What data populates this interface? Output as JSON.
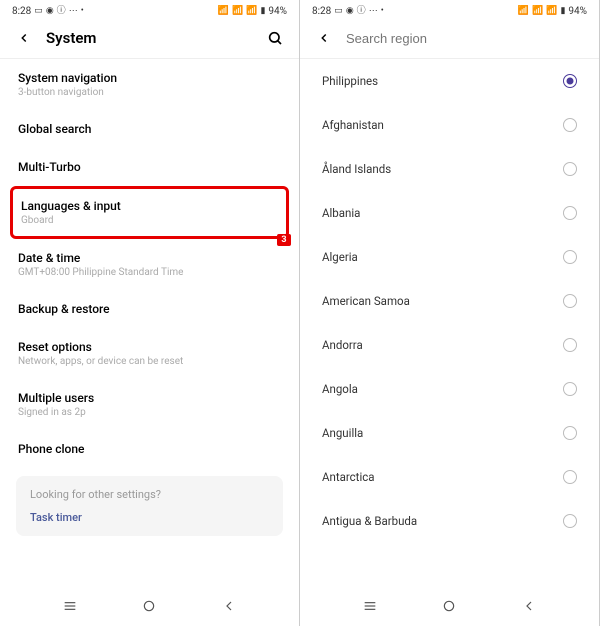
{
  "status": {
    "time": "8:28",
    "battery": "94%"
  },
  "left": {
    "header_title": "System",
    "highlight_badge": "3",
    "items": [
      {
        "title": "System navigation",
        "sub": "3-button navigation"
      },
      {
        "title": "Global search",
        "sub": ""
      },
      {
        "title": "Multi-Turbo",
        "sub": ""
      },
      {
        "title": "Languages & input",
        "sub": "Gboard"
      },
      {
        "title": "Date & time",
        "sub": "GMT+08:00 Philippine Standard Time"
      },
      {
        "title": "Backup & restore",
        "sub": ""
      },
      {
        "title": "Reset options",
        "sub": "Network, apps, or device can be reset"
      },
      {
        "title": "Multiple users",
        "sub": "Signed in as 2p"
      },
      {
        "title": "Phone clone",
        "sub": ""
      }
    ],
    "footer_question": "Looking for other settings?",
    "footer_link": "Task timer"
  },
  "right": {
    "search_placeholder": "Search region",
    "regions": [
      {
        "name": "Philippines",
        "selected": true
      },
      {
        "name": "Afghanistan",
        "selected": false
      },
      {
        "name": "Åland Islands",
        "selected": false
      },
      {
        "name": "Albania",
        "selected": false
      },
      {
        "name": "Algeria",
        "selected": false
      },
      {
        "name": "American Samoa",
        "selected": false
      },
      {
        "name": "Andorra",
        "selected": false
      },
      {
        "name": "Angola",
        "selected": false
      },
      {
        "name": "Anguilla",
        "selected": false
      },
      {
        "name": "Antarctica",
        "selected": false
      },
      {
        "name": "Antigua & Barbuda",
        "selected": false
      }
    ]
  }
}
